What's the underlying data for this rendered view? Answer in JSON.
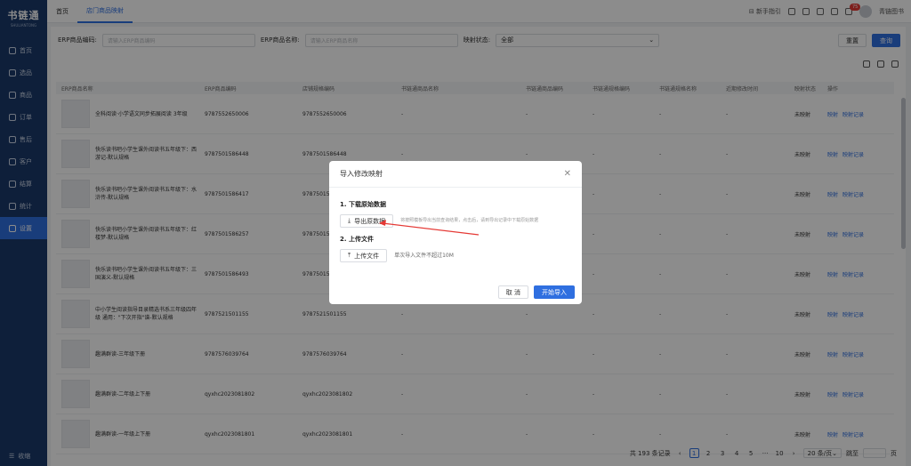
{
  "app": {
    "logo": "书链通",
    "logo_sub": "SHULIANTONG"
  },
  "sidebar": {
    "items": [
      {
        "label": "首页"
      },
      {
        "label": "选品"
      },
      {
        "label": "商品"
      },
      {
        "label": "订单"
      },
      {
        "label": "售后"
      },
      {
        "label": "客户"
      },
      {
        "label": "结算"
      },
      {
        "label": "统计"
      },
      {
        "label": "设置",
        "active": true
      }
    ],
    "collapse": "收缩"
  },
  "tabs": [
    {
      "label": "首页"
    },
    {
      "label": "店门商品映射",
      "active": true
    }
  ],
  "header": {
    "guide": "新手指引",
    "badge": "75",
    "user": "青链图书"
  },
  "filters": {
    "erp_code_label": "ERP商品编码:",
    "erp_code_placeholder": "请输入ERP商品编码",
    "erp_name_label": "ERP商品名称:",
    "erp_name_placeholder": "请输入ERP商品名称",
    "status_label": "映射状态:",
    "status_value": "全部",
    "reset": "重置",
    "search": "查询"
  },
  "table": {
    "headers": [
      "ERP商品名称",
      "ERP商品编码",
      "店铺规格编码",
      "书链通商品名称",
      "书链通商品编码",
      "书链通规格编码",
      "书链通规格名称",
      "近期修改时间",
      "映射状态",
      "操作"
    ],
    "rows": [
      {
        "name": "全科阅读·小学语文同步拓展阅读 3年级",
        "erp": "9787552650006",
        "shop": "9787552650006",
        "status": "未映射"
      },
      {
        "name": "快乐读书吧小学生课外阅读书五年级下：西游记-默认规格",
        "erp": "9787501586448",
        "shop": "9787501586448",
        "status": "未映射"
      },
      {
        "name": "快乐读书吧小学生课外阅读书五年级下：水浒传-默认规格",
        "erp": "9787501586417",
        "shop": "97875015",
        "status": "未映射"
      },
      {
        "name": "快乐读书吧小学生课外阅读书五年级下：红楼梦-默认规格",
        "erp": "9787501586257",
        "shop": "97875015",
        "status": "未映射"
      },
      {
        "name": "快乐读书吧小学生课外阅读书五年级下：三国演义-默认规格",
        "erp": "9787501586493",
        "shop": "97875015",
        "status": "未映射"
      },
      {
        "name": "中小学生阅读指导目录精选书系三年级四年级 通用：\"下次开指\"谱-默认规格",
        "erp": "9787521501155",
        "shop": "9787521501155",
        "status": "未映射"
      },
      {
        "name": "趣满群读-三年级下册",
        "erp": "9787576039764",
        "shop": "9787576039764",
        "status": "未映射"
      },
      {
        "name": "趣满群读-二年级上下册",
        "erp": "qyxhc2023081802",
        "shop": "qyxhc2023081802",
        "status": "未映射"
      },
      {
        "name": "趣满群读-一年级上下册",
        "erp": "qyxhc2023081801",
        "shop": "qyxhc2023081801",
        "status": "未映射"
      }
    ],
    "dash": "-",
    "op_map": "映射",
    "op_record": "映射记录"
  },
  "pager": {
    "total": "共 193 条记录",
    "pages": [
      "1",
      "2",
      "3",
      "4",
      "5",
      "···",
      "10"
    ],
    "size": "20 条/页",
    "goto": "跳至",
    "page_unit": "页"
  },
  "modal": {
    "title": "导入修改映射",
    "step1": "1. 下载原始数据",
    "export_btn": "导出原数据",
    "hint": "将按照模板导出当前查询结果，点击后，请到导出记录中下载原始数据",
    "step2": "2. 上传文件",
    "upload_btn": "上传文件",
    "upload_hint": "单次导入文件不超过10M",
    "cancel": "取 消",
    "confirm": "开始导入"
  }
}
